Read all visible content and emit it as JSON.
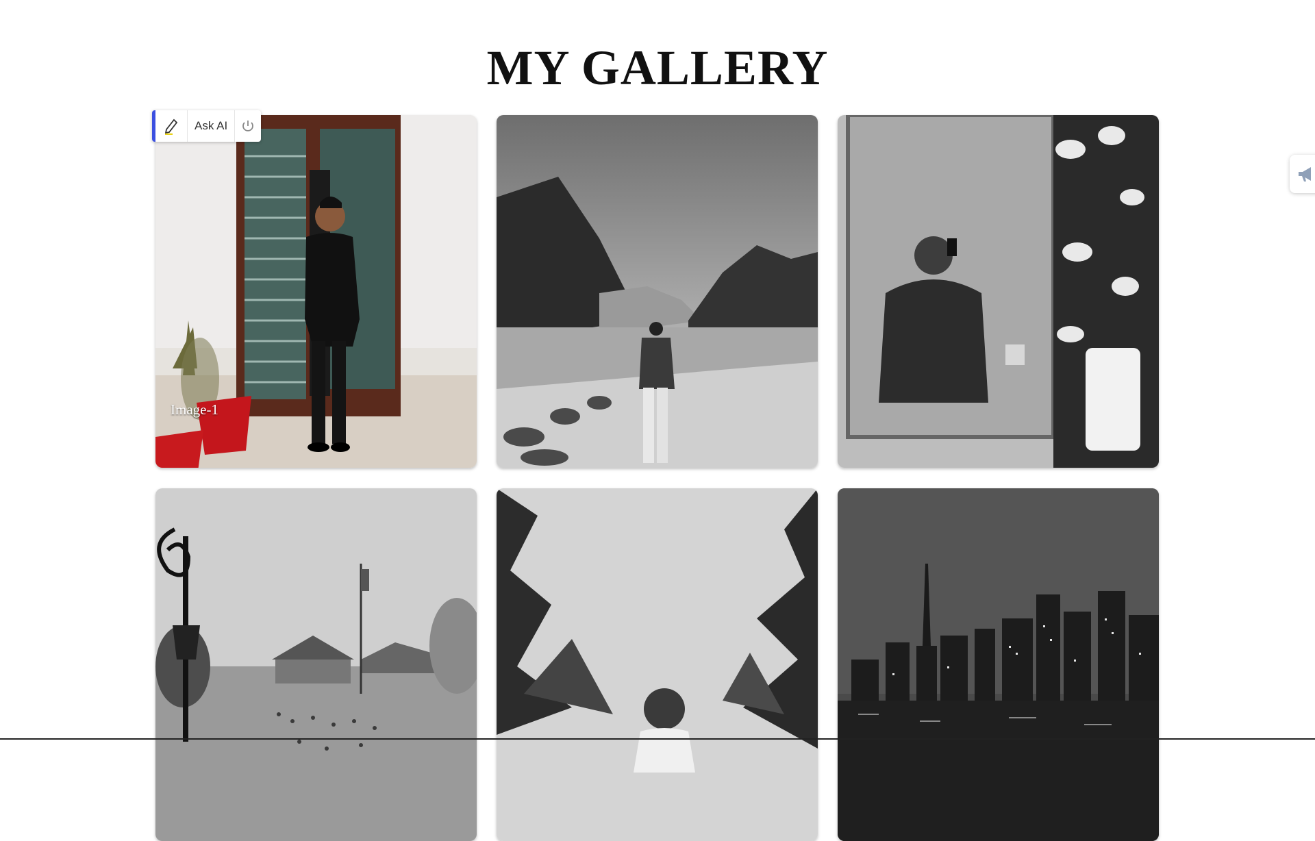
{
  "page": {
    "title": "MY GALLERY"
  },
  "toolbar": {
    "ask_ai_label": "Ask AI",
    "accent": "#3b4fe0",
    "pen_icon": "pencil-icon",
    "power_icon": "power-icon"
  },
  "side_tab": {
    "icon": "megaphone-icon"
  },
  "gallery": {
    "images": [
      {
        "label": "Image-1",
        "icon": "photo-man-in-suit-doorway"
      },
      {
        "label": "",
        "icon": "photo-man-at-mountain-lake"
      },
      {
        "label": "",
        "icon": "photo-mirror-selfie-hoodie"
      },
      {
        "label": "",
        "icon": "photo-crowd-town-square-lamp"
      },
      {
        "label": "",
        "icon": "photo-man-among-pine-trees"
      },
      {
        "label": "",
        "icon": "photo-city-skyline-night"
      }
    ]
  }
}
